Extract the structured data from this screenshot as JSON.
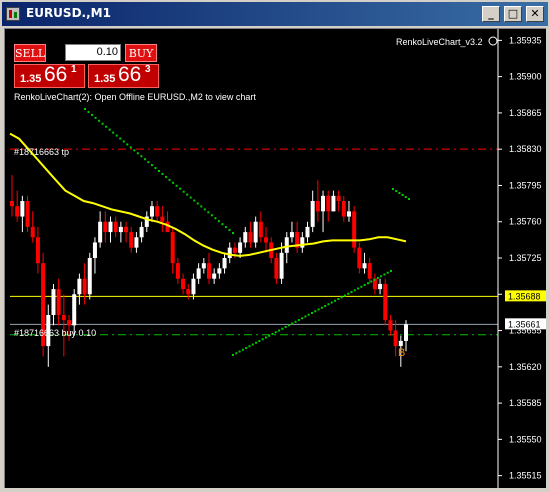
{
  "window": {
    "title": "EURUSD.,M1",
    "min_btn": "_",
    "max_btn": "□",
    "close_btn": "✕"
  },
  "indicator_name": "RenkoLiveChart_v3.2",
  "offline_message": "RenkoLiveChart(2): Open Offline EURUSD.,M2 to view chart",
  "trade_panel": {
    "sell_label": "SELL",
    "buy_label": "BUY",
    "lot": "0.10",
    "sell_price": {
      "prefix": "1.35",
      "big": "66",
      "sup": "1"
    },
    "buy_price": {
      "prefix": "1.35",
      "big": "66",
      "sup": "3"
    }
  },
  "order_labels": {
    "tp": "#18716663 tp",
    "buy": "#18716663 buy 0.10"
  },
  "arrow_label": "B",
  "price_axis": {
    "ticks": [
      "1.35935",
      "1.35900",
      "1.35865",
      "1.35830",
      "1.35795",
      "1.35760",
      "1.35725",
      "1.35690",
      "1.35655",
      "1.35620",
      "1.35585",
      "1.35550",
      "1.35515"
    ],
    "bid_tag": "1.35661",
    "line_tag": "1.35688"
  },
  "colors": {
    "background": "#000000",
    "bull": "#ffffff",
    "bear": "#ff0000",
    "ma": "#ffff00",
    "dots": "#00cc00",
    "tp_line": "#ff0000",
    "order_line": "#00c000",
    "hline": "#ffff00",
    "arrow": "#ff8c00"
  },
  "chart_data": {
    "type": "candlestick",
    "symbol": "EURUSD.",
    "timeframe": "M1",
    "y_range": [
      1.35505,
      1.35945
    ],
    "horizontal_levels": {
      "tp": 1.3583,
      "yellow": 1.35688,
      "order": 1.35651,
      "bid": 1.35661
    },
    "candles": [
      [
        1.3578,
        1.35805,
        1.35765,
        1.35775
      ],
      [
        1.35775,
        1.3579,
        1.3576,
        1.35765
      ],
      [
        1.35765,
        1.35785,
        1.3575,
        1.3578
      ],
      [
        1.3578,
        1.35785,
        1.3575,
        1.35755
      ],
      [
        1.35755,
        1.3577,
        1.3574,
        1.35745
      ],
      [
        1.35745,
        1.35755,
        1.3571,
        1.3572
      ],
      [
        1.3572,
        1.3573,
        1.3563,
        1.3564
      ],
      [
        1.3564,
        1.3568,
        1.3562,
        1.3567
      ],
      [
        1.3567,
        1.357,
        1.3566,
        1.35695
      ],
      [
        1.35695,
        1.35705,
        1.3566,
        1.3567
      ],
      [
        1.3567,
        1.3569,
        1.3563,
        1.35665
      ],
      [
        1.35665,
        1.3567,
        1.35645,
        1.3566
      ],
      [
        1.3566,
        1.35695,
        1.3565,
        1.3569
      ],
      [
        1.3569,
        1.3571,
        1.3568,
        1.35705
      ],
      [
        1.35705,
        1.3572,
        1.3568,
        1.3569
      ],
      [
        1.3569,
        1.3573,
        1.35685,
        1.35725
      ],
      [
        1.35725,
        1.35745,
        1.3571,
        1.3574
      ],
      [
        1.3574,
        1.3577,
        1.35735,
        1.3576
      ],
      [
        1.3576,
        1.3577,
        1.3574,
        1.3575
      ],
      [
        1.3575,
        1.35765,
        1.3574,
        1.3576
      ],
      [
        1.3576,
        1.35765,
        1.35745,
        1.3575
      ],
      [
        1.3575,
        1.3576,
        1.3574,
        1.35755
      ],
      [
        1.35755,
        1.3576,
        1.3574,
        1.3575
      ],
      [
        1.3575,
        1.35755,
        1.3573,
        1.35735
      ],
      [
        1.35735,
        1.3575,
        1.3573,
        1.35745
      ],
      [
        1.35745,
        1.3576,
        1.3574,
        1.35755
      ],
      [
        1.35755,
        1.3577,
        1.3575,
        1.35765
      ],
      [
        1.35765,
        1.3578,
        1.3576,
        1.35775
      ],
      [
        1.35775,
        1.3578,
        1.3576,
        1.35765
      ],
      [
        1.35765,
        1.35775,
        1.3575,
        1.3576
      ],
      [
        1.3576,
        1.3577,
        1.3575,
        1.3575
      ],
      [
        1.3575,
        1.35755,
        1.3571,
        1.3572
      ],
      [
        1.3572,
        1.35725,
        1.357,
        1.35705
      ],
      [
        1.35705,
        1.3571,
        1.3569,
        1.35695
      ],
      [
        1.35695,
        1.357,
        1.35685,
        1.3569
      ],
      [
        1.3569,
        1.3571,
        1.35685,
        1.35705
      ],
      [
        1.35705,
        1.3572,
        1.357,
        1.35715
      ],
      [
        1.35715,
        1.35725,
        1.3571,
        1.3572
      ],
      [
        1.3572,
        1.3573,
        1.357,
        1.35705
      ],
      [
        1.35705,
        1.35715,
        1.357,
        1.3571
      ],
      [
        1.3571,
        1.3572,
        1.35705,
        1.35715
      ],
      [
        1.35715,
        1.3573,
        1.3571,
        1.35725
      ],
      [
        1.35725,
        1.3574,
        1.3572,
        1.35735
      ],
      [
        1.35735,
        1.3574,
        1.35725,
        1.3573
      ],
      [
        1.3573,
        1.35745,
        1.35725,
        1.3574
      ],
      [
        1.3574,
        1.35755,
        1.35735,
        1.3575
      ],
      [
        1.3575,
        1.3576,
        1.35735,
        1.3574
      ],
      [
        1.3574,
        1.35765,
        1.35735,
        1.3576
      ],
      [
        1.3576,
        1.3577,
        1.3574,
        1.35745
      ],
      [
        1.35745,
        1.35755,
        1.3573,
        1.3574
      ],
      [
        1.3574,
        1.35745,
        1.3572,
        1.35725
      ],
      [
        1.35725,
        1.3573,
        1.357,
        1.35705
      ],
      [
        1.35705,
        1.3574,
        1.357,
        1.3573
      ],
      [
        1.3573,
        1.3575,
        1.3572,
        1.35745
      ],
      [
        1.35745,
        1.3576,
        1.3574,
        1.3575
      ],
      [
        1.3575,
        1.3576,
        1.3573,
        1.35735
      ],
      [
        1.35735,
        1.3575,
        1.3573,
        1.35745
      ],
      [
        1.35745,
        1.3576,
        1.3574,
        1.35755
      ],
      [
        1.35755,
        1.3579,
        1.3575,
        1.3578
      ],
      [
        1.3578,
        1.358,
        1.3576,
        1.3577
      ],
      [
        1.3577,
        1.3579,
        1.3575,
        1.35785
      ],
      [
        1.35785,
        1.3579,
        1.3576,
        1.3577
      ],
      [
        1.3577,
        1.3579,
        1.3577,
        1.35785
      ],
      [
        1.35785,
        1.3579,
        1.3577,
        1.3578
      ],
      [
        1.3578,
        1.35785,
        1.3576,
        1.35765
      ],
      [
        1.35765,
        1.3578,
        1.3576,
        1.3577
      ],
      [
        1.3577,
        1.35775,
        1.3573,
        1.35735
      ],
      [
        1.35735,
        1.3574,
        1.3571,
        1.35715
      ],
      [
        1.35715,
        1.3573,
        1.3571,
        1.3572
      ],
      [
        1.3572,
        1.35725,
        1.357,
        1.35705
      ],
      [
        1.35705,
        1.3571,
        1.3569,
        1.35695
      ],
      [
        1.35695,
        1.35705,
        1.3569,
        1.357
      ],
      [
        1.357,
        1.35705,
        1.3566,
        1.35665
      ],
      [
        1.35665,
        1.3567,
        1.3565,
        1.35655
      ],
      [
        1.35655,
        1.35665,
        1.3563,
        1.3564
      ],
      [
        1.3564,
        1.3565,
        1.3562,
        1.35645
      ],
      [
        1.35645,
        1.35665,
        1.35635,
        1.35661
      ]
    ],
    "ma": [
      1.35845,
      1.3584,
      1.3583,
      1.3582,
      1.3581,
      1.358,
      1.3579,
      1.35785,
      1.3578,
      1.35778,
      1.35775,
      1.35772,
      1.3577,
      1.35768,
      1.35765,
      1.35762,
      1.3576,
      1.35757,
      1.35753,
      1.35748,
      1.35742,
      1.35737,
      1.35733,
      1.3573,
      1.35728,
      1.35727,
      1.35728,
      1.3573,
      1.35732,
      1.35734,
      1.35736,
      1.35737,
      1.35738,
      1.35739,
      1.35741,
      1.35742,
      1.35742,
      1.35742,
      1.35742,
      1.35743,
      1.35745,
      1.35745,
      1.35743,
      1.35741
    ]
  }
}
